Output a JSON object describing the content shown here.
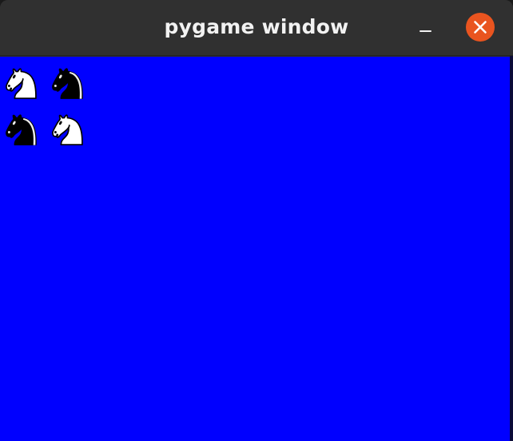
{
  "window": {
    "title": "pygame window",
    "controls": {
      "minimize_icon": "minimize-icon",
      "close_icon": "close-icon"
    }
  },
  "canvas": {
    "background_color": "#0000ff",
    "board": [
      [
        "white-knight",
        "black-knight"
      ],
      [
        "black-knight",
        "white-knight"
      ]
    ]
  },
  "colors": {
    "titlebar": "#303030",
    "title_text": "#f2f2f2",
    "close_button": "#e9541f",
    "canvas": "#0000ff"
  }
}
